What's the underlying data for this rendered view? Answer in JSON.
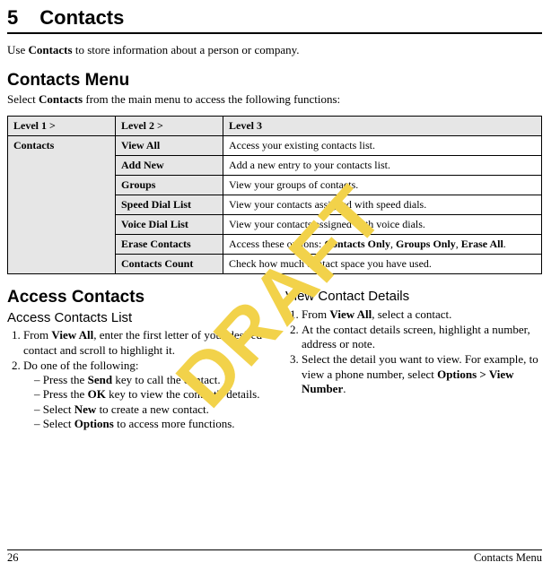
{
  "watermark": "DRAFT",
  "chapter": {
    "number": "5",
    "title": "Contacts"
  },
  "intro": {
    "pre": "Use ",
    "bold": "Contacts",
    "post": " to store information about a person or company."
  },
  "section1": {
    "heading": "Contacts Menu",
    "intro_pre": "Select ",
    "intro_bold": "Contacts",
    "intro_post": " from the main menu to access the following functions:"
  },
  "table": {
    "headers": [
      "Level 1 >",
      "Level 2 >",
      "Level 3"
    ],
    "level1": "Contacts",
    "rows": [
      {
        "l2": "View All",
        "l3": "Access your existing contacts list."
      },
      {
        "l2": "Add New",
        "l3": "Add a new entry to your contacts list."
      },
      {
        "l2": "Groups",
        "l3": "View your groups of contacts."
      },
      {
        "l2": "Speed Dial List",
        "l3": "View your contacts assigned with speed dials."
      },
      {
        "l2": "Voice Dial List",
        "l3": "View your contacts assigned with voice dials."
      },
      {
        "l2": "Erase Contacts",
        "l3_pre": "Access these options: ",
        "l3_b1": "Contacts Only",
        "l3_s1": ", ",
        "l3_b2": "Groups Only",
        "l3_s2": ", ",
        "l3_b3": "Erase All",
        "l3_post": "."
      },
      {
        "l2": "Contacts Count",
        "l3": "Check how much contact space you have used."
      }
    ]
  },
  "left": {
    "heading": "Access Contacts",
    "sub": "Access Contacts List",
    "step1_pre": "From ",
    "step1_bold": "View All",
    "step1_post": ", enter the first letter of your desired contact and scroll to highlight it.",
    "step2": "Do one of the following:",
    "bullets": {
      "b1_pre": "Press the ",
      "b1_bold": "Send",
      "b1_post": " key to call the contact.",
      "b2_pre": "Press the ",
      "b2_bold": "OK",
      "b2_post": " key to view the contact's details.",
      "b3_pre": "Select ",
      "b3_bold": "New",
      "b3_post": " to create a new contact.",
      "b4_pre": "Select ",
      "b4_bold": "Options",
      "b4_post": " to access more functions."
    }
  },
  "right": {
    "sub": "View Contact Details",
    "step1_pre": "From ",
    "step1_bold": "View All",
    "step1_post": ", select a contact.",
    "step2": "At the contact details screen, highlight a number, address or note.",
    "step3_pre": "Select the detail you want to view. For example, to view a phone number, select ",
    "step3_bold": "Options > View Number",
    "step3_post": "."
  },
  "footer": {
    "page": "26",
    "section": "Contacts Menu"
  }
}
